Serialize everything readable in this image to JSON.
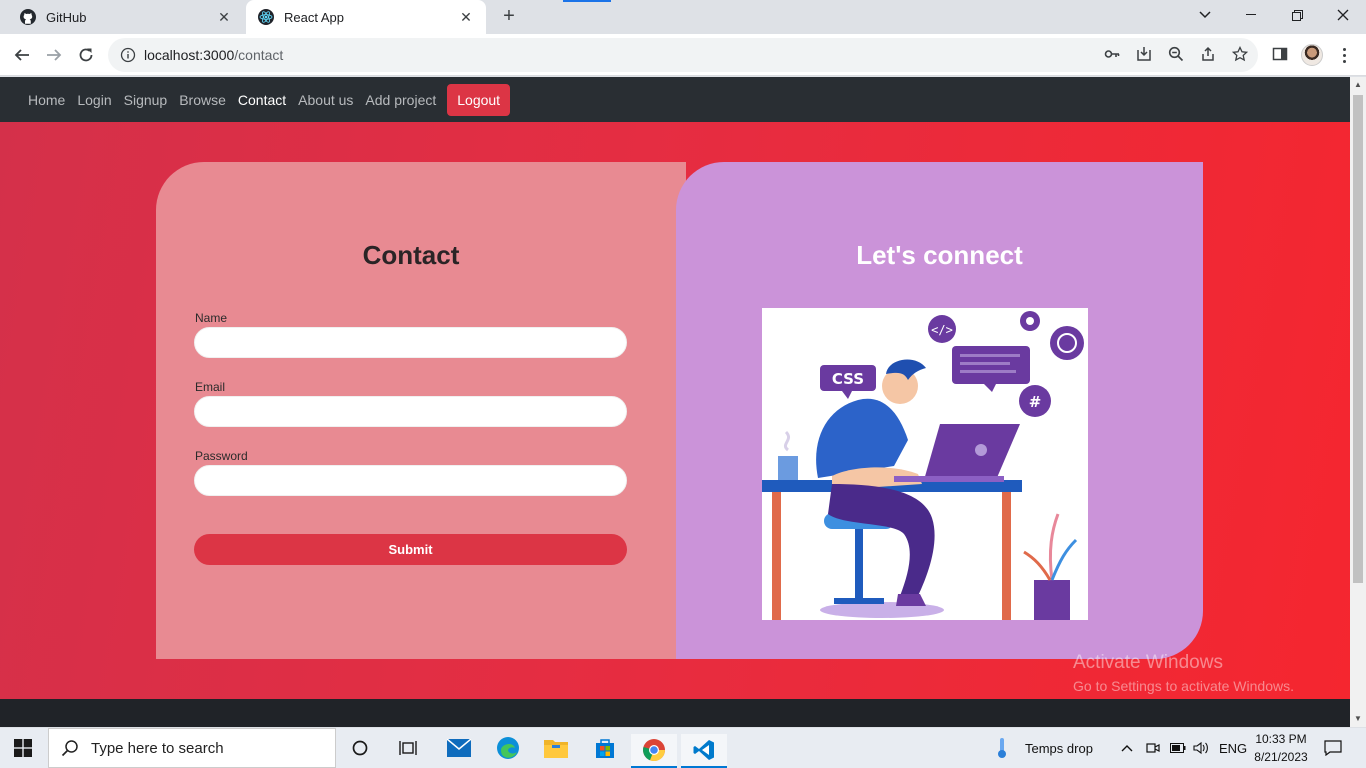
{
  "browser": {
    "tabs": [
      {
        "title": "GitHub",
        "icon": "github-icon"
      },
      {
        "title": "React App",
        "icon": "react-icon"
      }
    ],
    "new_tab": "+",
    "url_host": "localhost:3000",
    "url_path": "/contact"
  },
  "nav": {
    "items": [
      "Home",
      "Login",
      "Signup",
      "Browse",
      "Contact",
      "About us",
      "Add project"
    ],
    "active": "Contact",
    "logout": "Logout"
  },
  "contact_form": {
    "title": "Contact",
    "name_label": "Name",
    "email_label": "Email",
    "password_label": "Password",
    "name_value": "",
    "email_value": "",
    "password_value": "",
    "submit": "Submit"
  },
  "connect_panel": {
    "title": "Let's connect",
    "illustration_tags": {
      "css": "CSS",
      "code": "</>",
      "hash": "#"
    }
  },
  "watermark": {
    "line1": "Activate Windows",
    "line2": "Go to Settings to activate Windows."
  },
  "taskbar": {
    "search_placeholder": "Type here to search",
    "weather": "Temps drop",
    "language": "ENG",
    "time": "10:33 PM",
    "date": "8/21/2023"
  },
  "colors": {
    "navbar": "#292e33",
    "danger": "#dc3545",
    "left_card": "#e88a92",
    "right_card": "#cb93d9",
    "background_start": "#d4304a",
    "background_end": "#f5262f"
  }
}
